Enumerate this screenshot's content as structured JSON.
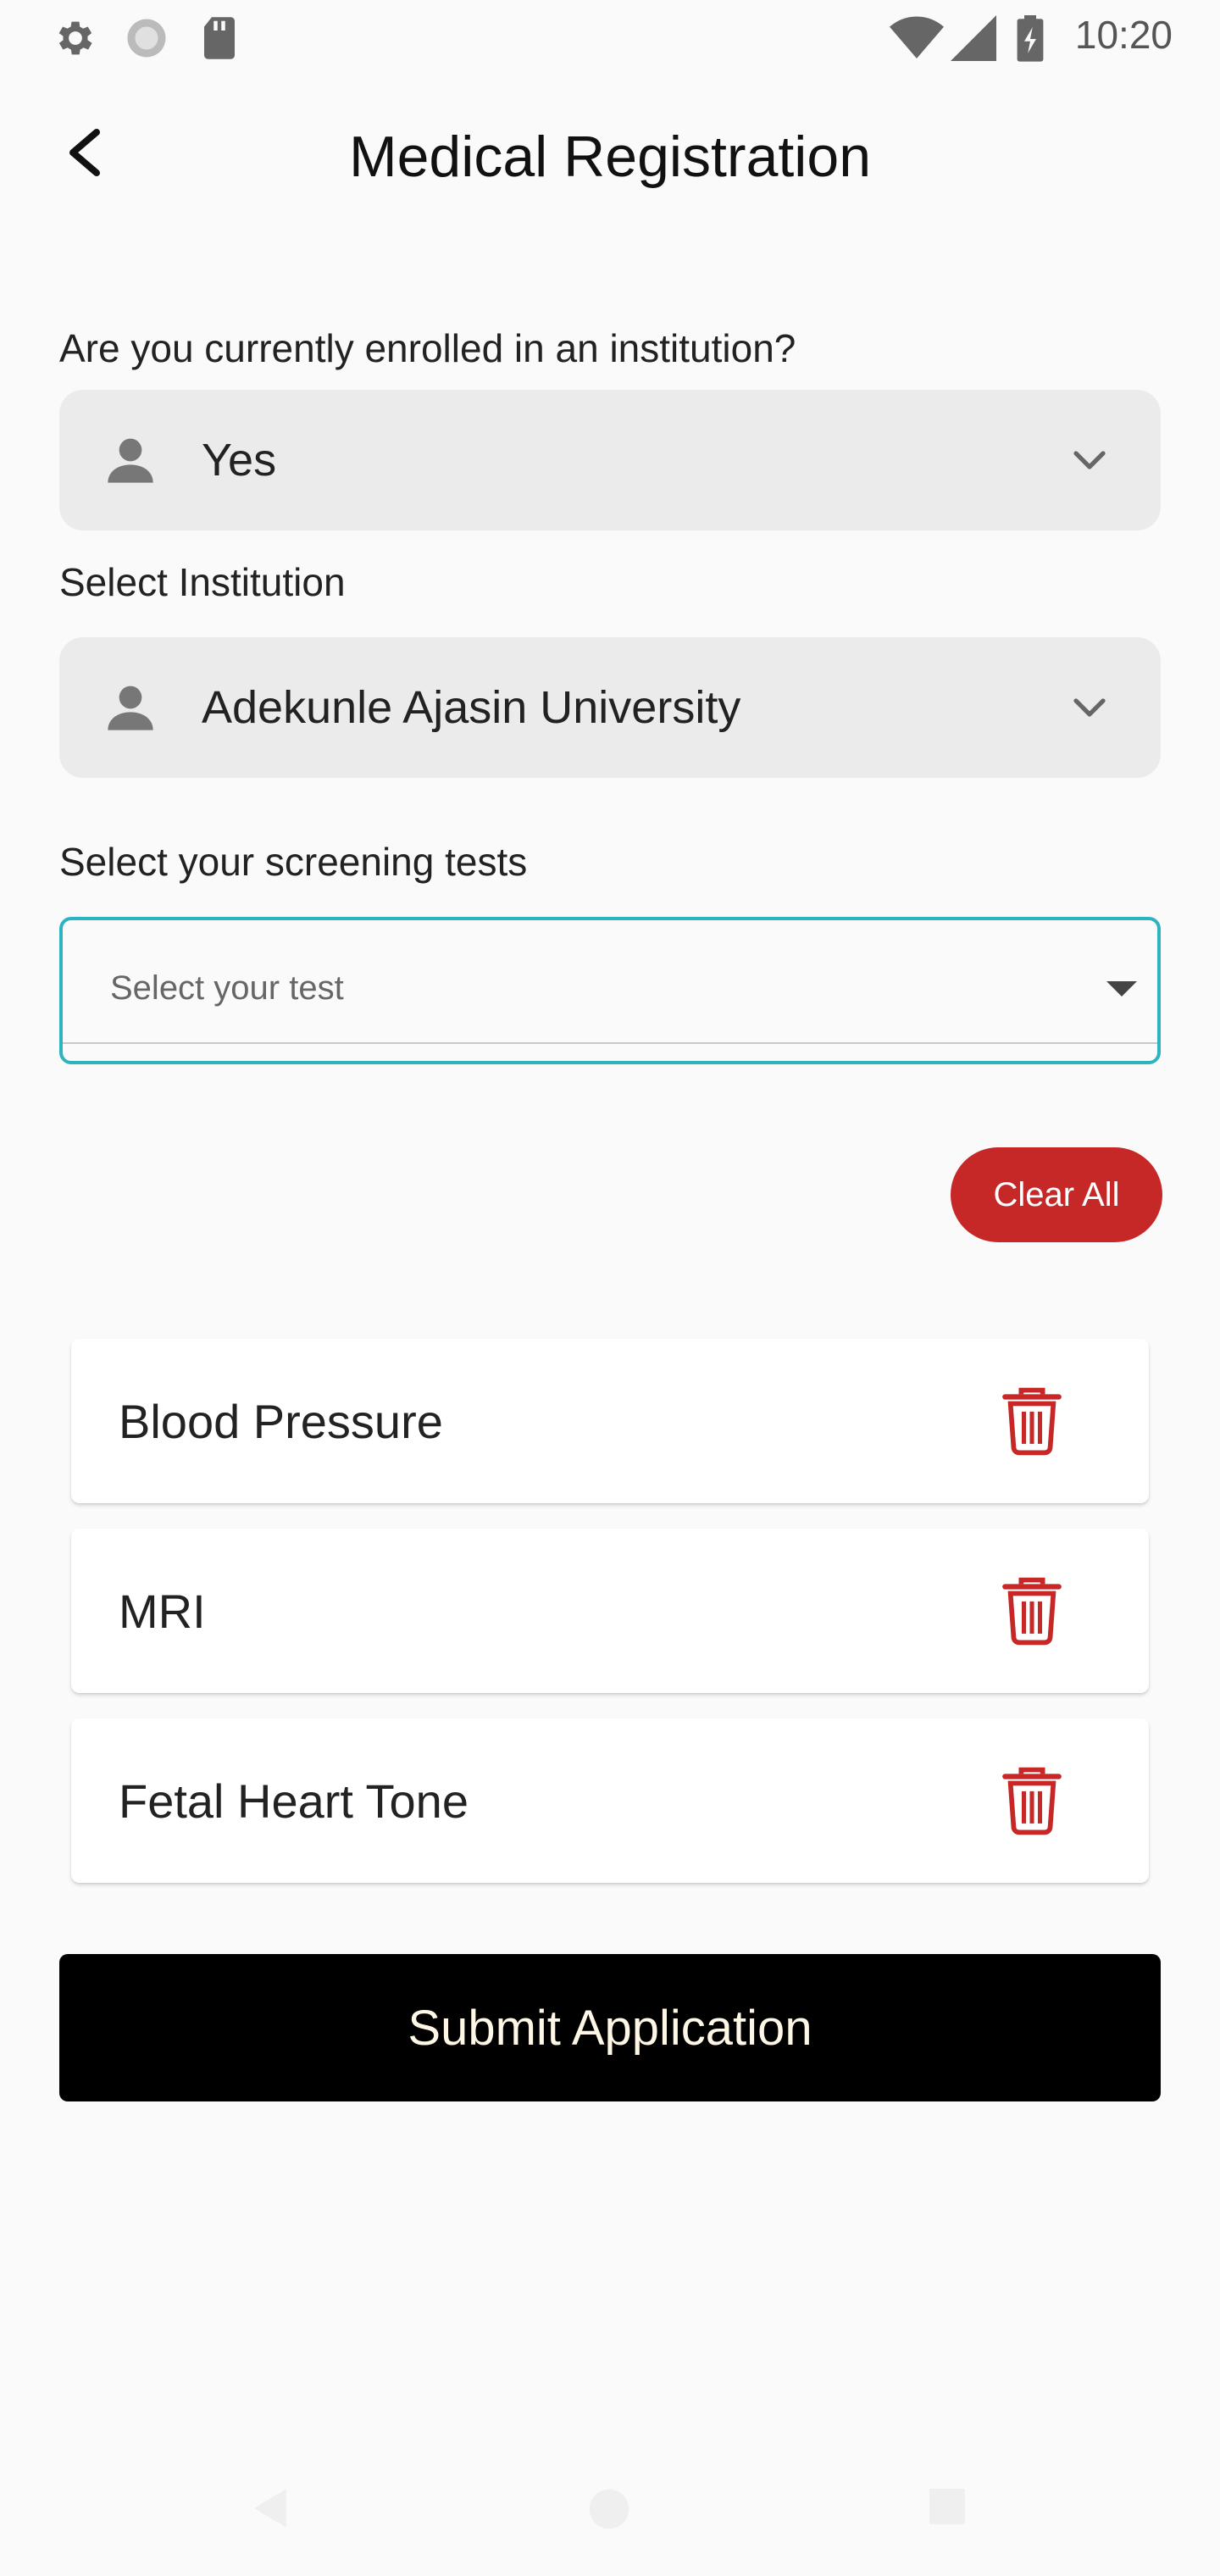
{
  "status_bar": {
    "time": "10:20",
    "left_icons": [
      "settings-icon",
      "sync-icon",
      "sd-card-icon"
    ],
    "right_icons": [
      "wifi-icon",
      "signal-icon",
      "battery-icon"
    ]
  },
  "header": {
    "title": "Medical Registration",
    "back_icon": "back-arrow-icon"
  },
  "enrollment": {
    "label": "Are you currently enrolled in an institution?",
    "value": "Yes"
  },
  "institution": {
    "label": "Select Institution",
    "value": "Adekunle Ajasin University"
  },
  "screening": {
    "label": "Select your screening tests",
    "placeholder": "Select your test"
  },
  "clear_all_label": "Clear All",
  "tests": [
    {
      "name": "Blood Pressure"
    },
    {
      "name": "MRI"
    },
    {
      "name": "Fetal Heart Tone"
    }
  ],
  "submit_label": "Submit Application",
  "colors": {
    "accent": "#c62828",
    "focus_border": "#2bb3c0",
    "submit_bg": "#000000"
  }
}
